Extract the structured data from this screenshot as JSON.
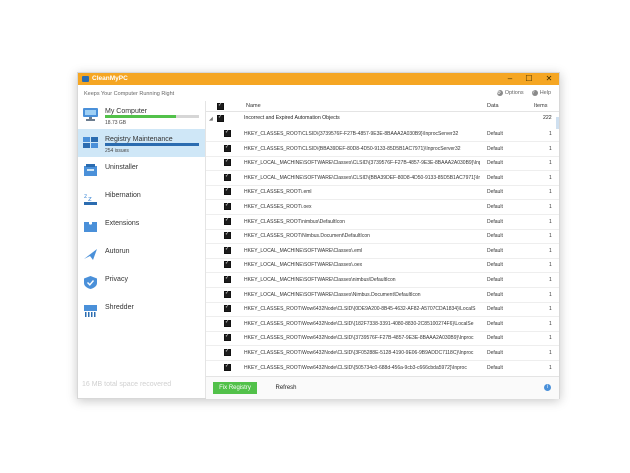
{
  "window": {
    "title": "CleanMyPC",
    "tagline": "Keeps Your Computer Running Right",
    "options_label": "Options",
    "help_label": "Help",
    "controls": [
      "–",
      "☐",
      "✕"
    ]
  },
  "sidebar": {
    "items": [
      {
        "label": "My Computer",
        "sub": "18.73 GB",
        "icon": "computer-icon",
        "progress": 0.76,
        "bar_color": "#52c14a"
      },
      {
        "label": "Registry Maintenance",
        "sub": "254 issues",
        "icon": "registry-icon",
        "progress": 1.0,
        "bar_color": "#2b6cb0",
        "selected": true
      },
      {
        "label": "Uninstaller",
        "icon": "uninstaller-icon"
      },
      {
        "label": "Hibernation",
        "icon": "hibernation-icon"
      },
      {
        "label": "Extensions",
        "icon": "extensions-icon"
      },
      {
        "label": "Autorun",
        "icon": "autorun-icon"
      },
      {
        "label": "Privacy",
        "icon": "privacy-icon"
      },
      {
        "label": "Shredder",
        "icon": "shredder-icon"
      }
    ],
    "freed": "16 MB total space recovered"
  },
  "table": {
    "headers": {
      "name": "Name",
      "data": "Data",
      "items": "Items"
    },
    "group": {
      "name": "Incorrect and Expired Automation Objects",
      "count": "222"
    },
    "rows": [
      {
        "key": "HKEY_CLASSES_ROOT\\CLSID\\{3739576F-F27B-4857-9E3E-8BAAA2A030B9}\\InprocServer32",
        "data": "Default",
        "count": "1"
      },
      {
        "key": "HKEY_CLASSES_ROOT\\CLSID\\{BBA39DEF-80D8-4D50-9133-85D5B1AC7971}\\InprocServer32",
        "data": "Default",
        "count": "1"
      },
      {
        "key": "HKEY_LOCAL_MACHINE\\SOFTWARE\\Classes\\CLSID\\{3739576F-F27B-4857-9E3E-8BAAA2A030B9}\\Inproc",
        "data": "Default",
        "count": "1"
      },
      {
        "key": "HKEY_LOCAL_MACHINE\\SOFTWARE\\Classes\\CLSID\\{BBA39DEF-80D8-4D50-9133-85D5B1AC7971}\\Inproc",
        "data": "Default",
        "count": "1"
      },
      {
        "key": "HKEY_CLASSES_ROOT\\.eml",
        "data": "Default",
        "count": "1"
      },
      {
        "key": "HKEY_CLASSES_ROOT\\.oex",
        "data": "Default",
        "count": "1"
      },
      {
        "key": "HKEY_CLASSES_ROOT\\nimbus\\DefaultIcon",
        "data": "Default",
        "count": "1"
      },
      {
        "key": "HKEY_CLASSES_ROOT\\Nimbus.Document\\DefaultIcon",
        "data": "Default",
        "count": "1"
      },
      {
        "key": "HKEY_LOCAL_MACHINE\\SOFTWARE\\Classes\\.eml",
        "data": "Default",
        "count": "1"
      },
      {
        "key": "HKEY_LOCAL_MACHINE\\SOFTWARE\\Classes\\.oex",
        "data": "Default",
        "count": "1"
      },
      {
        "key": "HKEY_LOCAL_MACHINE\\SOFTWARE\\Classes\\nimbus\\DefaultIcon",
        "data": "Default",
        "count": "1"
      },
      {
        "key": "HKEY_LOCAL_MACHINE\\SOFTWARE\\Classes\\Nimbus.Document\\DefaultIcon",
        "data": "Default",
        "count": "1"
      },
      {
        "key": "HKEY_CLASSES_ROOT\\Wow6432Node\\CLSID\\{0DE9A200-8B45-4632-AF82-A5707CDA1834}\\LocalS",
        "data": "Default",
        "count": "1"
      },
      {
        "key": "HKEY_CLASSES_ROOT\\Wow6432Node\\CLSID\\{182F7338-3391-4080-8830-2C85100274F6}\\LocalSe",
        "data": "Default",
        "count": "1"
      },
      {
        "key": "HKEY_CLASSES_ROOT\\Wow6432Node\\CLSID\\{3739576F-F27B-4857-9E3E-8BAAA2A030B9}\\Inproc",
        "data": "Default",
        "count": "1"
      },
      {
        "key": "HKEY_CLASSES_ROOT\\Wow6432Node\\CLSID\\{3F05288E-5128-4190-9E06-9B9ADDC7118C}\\Inproc",
        "data": "Default",
        "count": "1"
      },
      {
        "key": "HKEY_CLASSES_ROOT\\Wow6432Node\\CLSID\\{505734c0-688d-456a-9cb3-c666cbda5972}\\Inproc",
        "data": "Default",
        "count": "1"
      }
    ]
  },
  "footer": {
    "fix_label": "Fix Registry",
    "refresh_label": "Refresh",
    "info_glyph": "i"
  },
  "colors": {
    "accent": "#f5a623",
    "fix_button": "#52c14a",
    "selected_bg": "#cfe7f7"
  }
}
